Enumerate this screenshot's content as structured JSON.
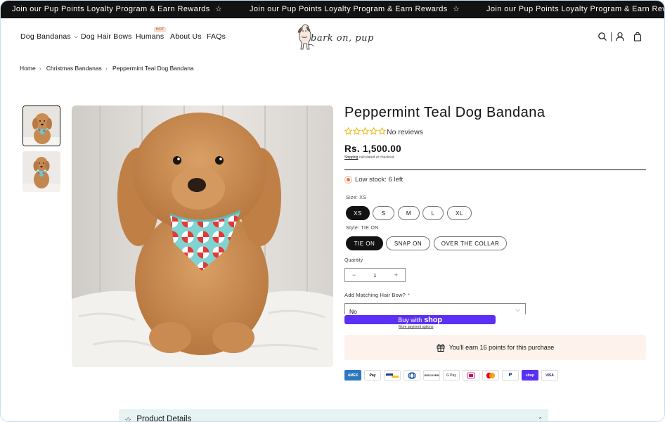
{
  "announcement": {
    "message": "Join our Pup Points Loyalty Program & Earn Rewards"
  },
  "header": {
    "nav": [
      "Dog Bandanas",
      "Dog Hair Bows",
      "Humans",
      "About Us",
      "FAQs"
    ],
    "hot_badge": "HOT",
    "logo_text": "bark on, pup",
    "icons": [
      "search-icon",
      "account-icon",
      "cart-icon"
    ]
  },
  "breadcrumb": [
    "Home",
    "Christmas Bandanas",
    "Peppermint Teal Dog Bandana"
  ],
  "product": {
    "title": "Peppermint Teal Dog Bandana",
    "reviews": "No reviews",
    "price": "Rs. 1,500.00",
    "shipping_link": "Shipping",
    "shipping_rest": " calculated at checkout.",
    "stock": "Low stock: 6 left",
    "size_label": "Size: XS",
    "sizes": [
      "XS",
      "S",
      "M",
      "L",
      "XL"
    ],
    "selected_size": "XS",
    "style_label": "Style: TIE ON",
    "styles": [
      "TIE ON",
      "SNAP ON",
      "OVER THE COLLAR"
    ],
    "selected_style": "TIE ON",
    "quantity_label": "Quantity",
    "quantity": "1",
    "bow_label": "Add Matching Hair Bow?",
    "bow_required": "*",
    "bow_value": "No",
    "shop_pay_prefix": "Buy with",
    "shop_pay_brand": "shop",
    "more_payment": "More payment options",
    "points_text": "You'll earn 16 points for this purchase",
    "payment_methods": [
      "AMEX",
      "Pay",
      "",
      "",
      "DISCOVER",
      "G Pay",
      "",
      "",
      "P",
      "shop",
      "VISA"
    ]
  },
  "details": {
    "title": "Product Details"
  },
  "colors": {
    "announcement_bg": "#121212",
    "accent_shop": "#5a31f4",
    "stars": "#e8b400",
    "points_bg": "#fdf3ec",
    "details_bg": "#e6f3f2"
  }
}
